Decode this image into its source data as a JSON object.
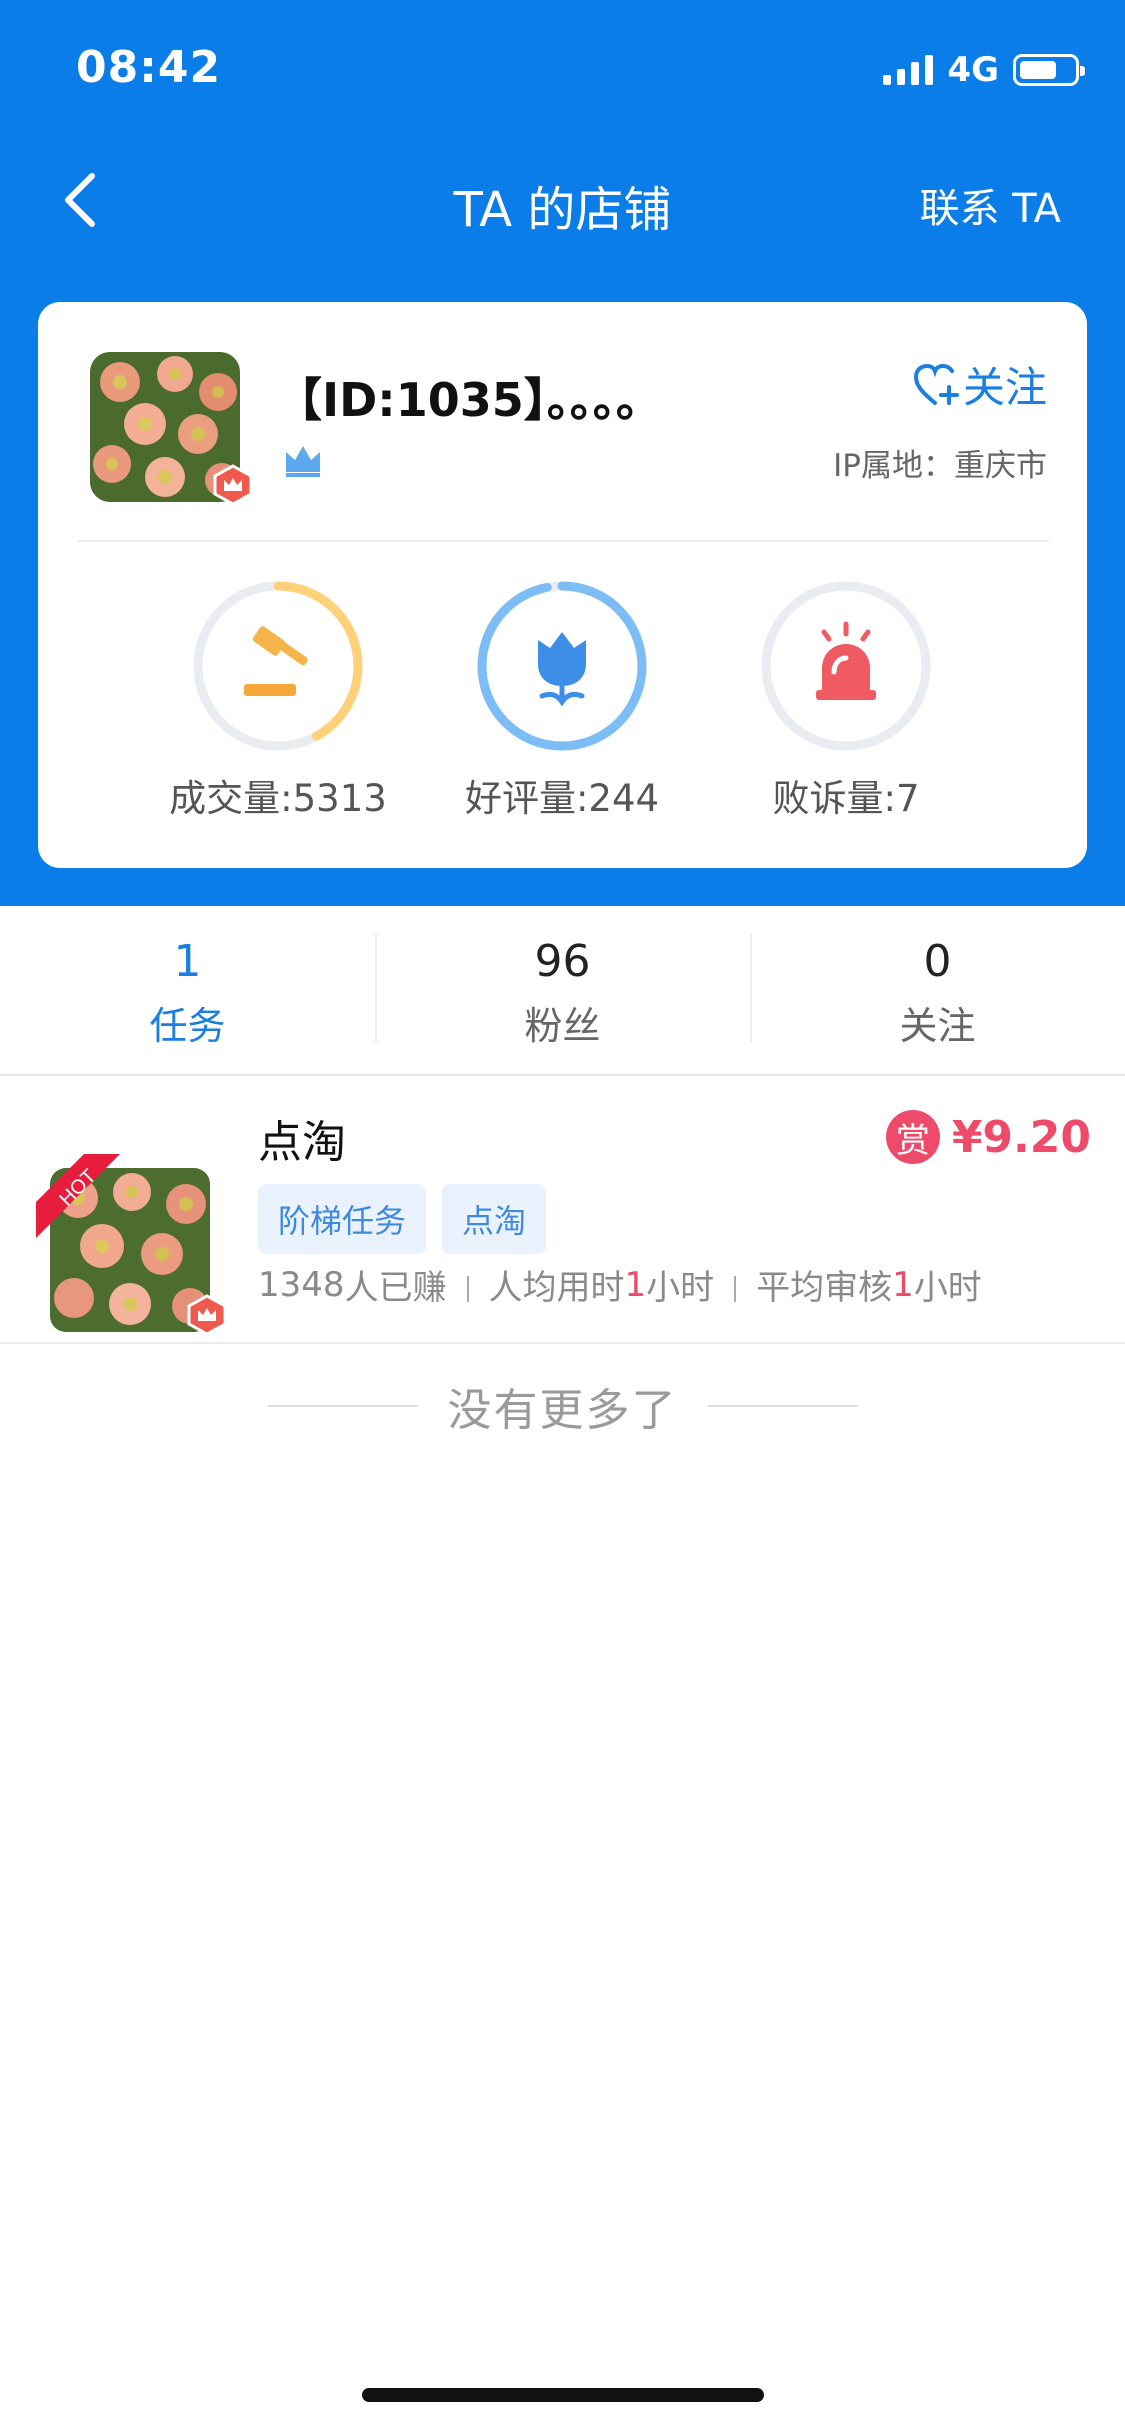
{
  "status_bar": {
    "time": "08:42",
    "network": "4G"
  },
  "nav": {
    "title": "TA 的店铺",
    "contact_label": "联系 TA"
  },
  "shop": {
    "name": "【ID:1035】。。。。",
    "follow_label": "关注",
    "ip_location": "IP属地：重庆市",
    "metrics": [
      {
        "label": "成交量:5313",
        "icon": "gavel-icon",
        "ring_color": "#ffd27a",
        "ring_fraction": 0.42
      },
      {
        "label": "好评量:244",
        "icon": "flower-icon",
        "ring_color": "#7cbdf5",
        "ring_fraction": 0.97
      },
      {
        "label": "败诉量:7",
        "icon": "alarm-icon",
        "ring_color": "#e9ecf1",
        "ring_fraction": 0.0
      }
    ]
  },
  "counters": [
    {
      "value": "1",
      "label": "任务",
      "active": true
    },
    {
      "value": "96",
      "label": "粉丝",
      "active": false
    },
    {
      "value": "0",
      "label": "关注",
      "active": false
    }
  ],
  "task": {
    "hot_label": "HOT",
    "title": "点淘",
    "reward_icon_char": "赏",
    "reward_amount": "¥9.20",
    "tags": [
      "阶梯任务",
      "点淘"
    ],
    "earned_count": "1348",
    "earned_suffix": "人已赚",
    "avg_time_prefix": "人均用时",
    "avg_time_value": "1",
    "avg_time_unit": "小时",
    "avg_review_prefix": "平均审核",
    "avg_review_value": "1",
    "avg_review_unit": "小时"
  },
  "footer": {
    "no_more": "没有更多了"
  },
  "colors": {
    "brand_blue": "#0a7de8",
    "accent_red": "#ee4b6a",
    "link_blue": "#1a7fe0"
  }
}
